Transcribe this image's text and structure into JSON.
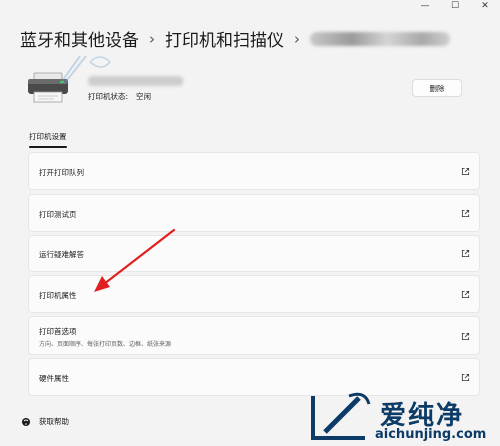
{
  "window": {
    "controls": {
      "minimize": "—",
      "maximize": "☐",
      "close": "✕"
    }
  },
  "breadcrumb": {
    "items": [
      "蓝牙和其他设备",
      "打印机和扫描仪"
    ],
    "separator": "›"
  },
  "printer": {
    "status_label": "打印机状态:",
    "status_value": "空闲",
    "delete_label": "删除"
  },
  "tabs": {
    "settings": "打印机设置"
  },
  "cards": [
    {
      "label": "打开打印队列",
      "sub": ""
    },
    {
      "label": "打印测试页",
      "sub": ""
    },
    {
      "label": "运行疑难解答",
      "sub": ""
    },
    {
      "label": "打印机属性",
      "sub": ""
    },
    {
      "label": "打印首选项",
      "sub": "方向、页面顺序、每张打印页数、边框、纸张来源"
    },
    {
      "label": "硬件属性",
      "sub": ""
    }
  ],
  "help": {
    "label": "获取帮助"
  },
  "watermark": {
    "brand_cn": "爱纯净",
    "brand_en": "aichunjing.com"
  },
  "colors": {
    "background": "#f3f3f3",
    "card": "#fbfbfb",
    "arrow": "#e02020",
    "brand": "#0b3b66"
  },
  "icons": {
    "external_link": "external-link-icon",
    "help": "help-icon",
    "printer": "printer-icon"
  }
}
